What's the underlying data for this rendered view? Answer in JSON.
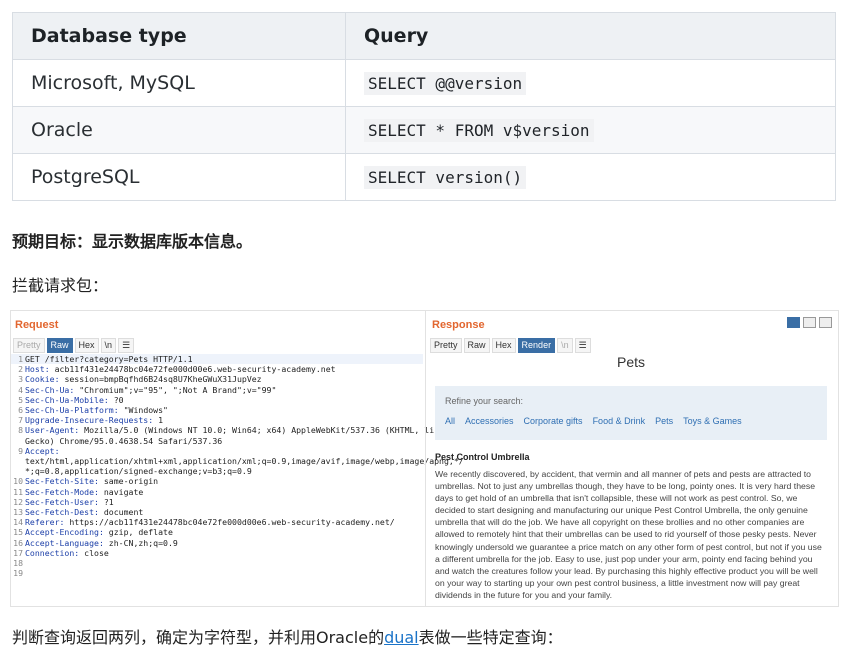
{
  "table": {
    "headers": [
      "Database type",
      "Query"
    ],
    "rows": [
      {
        "db": "Microsoft, MySQL",
        "query": "SELECT @@version"
      },
      {
        "db": "Oracle",
        "query": "SELECT * FROM v$version"
      },
      {
        "db": "PostgreSQL",
        "query": "SELECT version()"
      }
    ]
  },
  "goal_text": "预期目标：显示数据库版本信息。",
  "intercept_text": "拦截请求包：",
  "burp": {
    "request_title": "Request",
    "request_tabs": [
      "Pretty",
      "Raw",
      "Hex",
      "\\n",
      "☰"
    ],
    "request_lines": [
      {
        "n": "1",
        "k": "",
        "v": "GET /filter?category=Pets HTTP/1.1"
      },
      {
        "n": "2",
        "k": "Host:",
        "v": " acb11f431e24478bc04e72fe000d00e6.web-security-academy.net"
      },
      {
        "n": "3",
        "k": "Cookie:",
        "v": " session=bmpBqfhd6B24sq8U7KheGWuX31JupVez"
      },
      {
        "n": "4",
        "k": "Sec-Ch-Ua:",
        "v": " \"Chromium\";v=\"95\", \";Not A Brand\";v=\"99\""
      },
      {
        "n": "5",
        "k": "Sec-Ch-Ua-Mobile:",
        "v": " ?0"
      },
      {
        "n": "6",
        "k": "Sec-Ch-Ua-Platform:",
        "v": " \"Windows\""
      },
      {
        "n": "7",
        "k": "Upgrade-Insecure-Requests:",
        "v": " 1"
      },
      {
        "n": "8",
        "k": "User-Agent:",
        "v": " Mozilla/5.0 (Windows NT 10.0; Win64; x64) AppleWebKit/537.36 (KHTML, like"
      },
      {
        "n": "",
        "k": "",
        "v": "Gecko) Chrome/95.0.4638.54 Safari/537.36"
      },
      {
        "n": "9",
        "k": "Accept:",
        "v": ""
      },
      {
        "n": "",
        "k": "",
        "v": "text/html,application/xhtml+xml,application/xml;q=0.9,image/avif,image/webp,image/apng,*/"
      },
      {
        "n": "",
        "k": "",
        "v": "*;q=0.8,application/signed-exchange;v=b3;q=0.9"
      },
      {
        "n": "10",
        "k": "Sec-Fetch-Site:",
        "v": " same-origin"
      },
      {
        "n": "11",
        "k": "Sec-Fetch-Mode:",
        "v": " navigate"
      },
      {
        "n": "12",
        "k": "Sec-Fetch-User:",
        "v": " ?1"
      },
      {
        "n": "13",
        "k": "Sec-Fetch-Dest:",
        "v": " document"
      },
      {
        "n": "14",
        "k": "Referer:",
        "v": " https://acb11f431e24478bc04e72fe000d00e6.web-security-academy.net/"
      },
      {
        "n": "15",
        "k": "Accept-Encoding:",
        "v": " gzip, deflate"
      },
      {
        "n": "16",
        "k": "Accept-Language:",
        "v": " zh-CN,zh;q=0.9"
      },
      {
        "n": "17",
        "k": "Connection:",
        "v": " close"
      },
      {
        "n": "18",
        "k": "",
        "v": ""
      },
      {
        "n": "19",
        "k": "",
        "v": ""
      }
    ],
    "response_title": "Response",
    "response_tabs": [
      "Pretty",
      "Raw",
      "Hex",
      "Render",
      "\\n",
      "☰"
    ],
    "page_title": "Pets",
    "refine_label": "Refine your search:",
    "refine_links": [
      "All",
      "Accessories",
      "Corporate gifts",
      "Food & Drink",
      "Pets",
      "Toys & Games"
    ],
    "product_title": "Pest Control Umbrella",
    "product_desc": "We recently discovered, by accident, that vermin and all manner of pets and pests are attracted to umbrellas. Not to just any umbrellas though, they have to be long, pointy ones. It is very hard these days to get hold of an umbrella that isn't collapsible, these will not work as pest control. So, we decided to start designing and manufacturing our unique Pest Control Umbrella, the only genuine umbrella that will do the job. We have all copyright on these brollies and no other companies are allowed to remotely hint that their umbrellas can be used to rid yourself of those pesky pests. Never knowingly undersold we guarantee a price match on any other form of pest control, but not if you use a different umbrella for the job. Easy to use, just pop under your arm, pointy end facing behind you and watch the creatures follow your lead. By purchasing this highly effective product you will be well on your way to starting up your own pest control business, a little investment now will pay great dividends in the future for you and your family."
  },
  "conclusion": {
    "before": "判断查询返回两列，确定为字符型，并利用Oracle的",
    "link": "dual",
    "after": "表做一些特定查询："
  }
}
